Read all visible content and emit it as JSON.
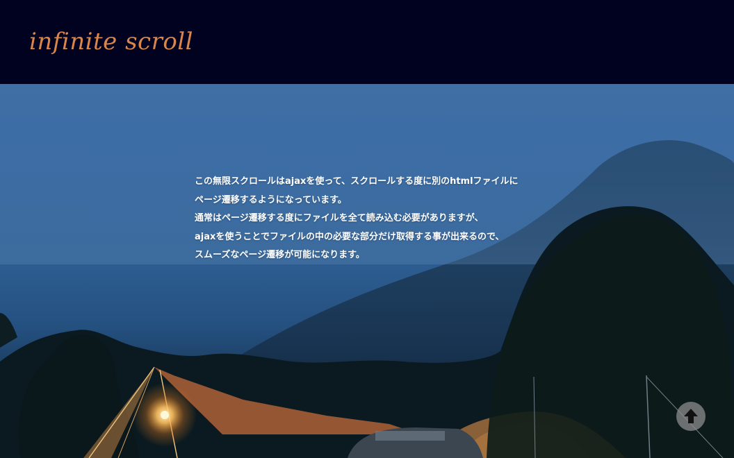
{
  "header": {
    "logo_text": "infinite scroll",
    "logo_color": "#d9864c",
    "background_color": "#01021f"
  },
  "hero": {
    "image_subject": "campsite tent lit by a lantern at dusk below a misty forested mountain",
    "paragraphs": [
      "この無限スクロールはajaxを使って、スクロールする度に別のhtmlファイルに",
      "ページ遷移するようになっています。",
      "通常はページ遷移する度にファイルを全て読み込む必要がありますが、",
      "ajaxを使うことでファイルの中の必要な部分だけ取得する事が出来るので、",
      "スムーズなページ遷移が可能になります。"
    ]
  },
  "controls": {
    "scroll_top_icon": "arrow-up-icon"
  }
}
